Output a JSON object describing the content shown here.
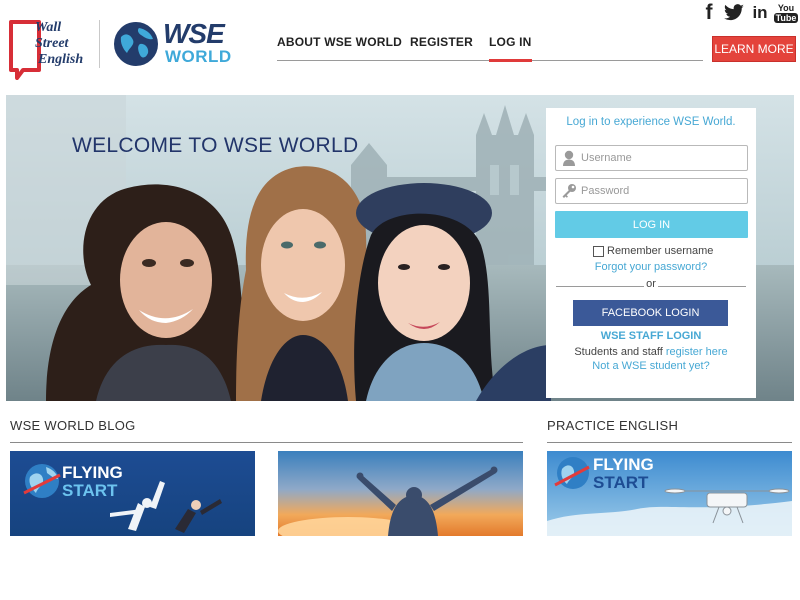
{
  "brand": {
    "wse_line1": "Wall",
    "wse_line2": "Street",
    "wse_line3": "English",
    "world_top": "WSE",
    "world_bottom": "WORLD"
  },
  "nav": {
    "items": [
      {
        "label": "ABOUT WSE WORLD"
      },
      {
        "label": "REGISTER"
      },
      {
        "label": "LOG IN",
        "active": true
      }
    ]
  },
  "social": {
    "facebook_glyph": "f",
    "youtube_top": "You",
    "youtube_bottom": "Tube",
    "linkedin_glyph": "in",
    "icons": [
      "facebook-icon",
      "twitter-icon",
      "linkedin-icon",
      "youtube-icon"
    ]
  },
  "header_cta": {
    "label": "LEARN MORE"
  },
  "hero": {
    "title": "WELCOME TO WSE WORLD"
  },
  "login": {
    "intro": "Log in to experience WSE World.",
    "username_placeholder": "Username",
    "password_placeholder": "Password",
    "submit_label": "LOG IN",
    "remember_label": "Remember username",
    "forgot_link": "Forgot your password?",
    "or_text": "or",
    "facebook_label": "FACEBOOK LOGIN",
    "staff_link": "WSE STAFF LOGIN",
    "students_prefix": "Students and staff ",
    "register_link": "register here",
    "not_student_link": "Not a WSE student yet?"
  },
  "sections": {
    "blog_title": "WSE WORLD BLOG",
    "practice_title": "PRACTICE ENGLISH"
  },
  "cards": {
    "flying_top": "FLYING",
    "flying_bottom": "START"
  },
  "colors": {
    "brand_red": "#e4433b",
    "navy": "#22356a",
    "accent_blue": "#47a8d4",
    "login_button": "#62cbe6",
    "facebook_blue": "#3b5998"
  }
}
